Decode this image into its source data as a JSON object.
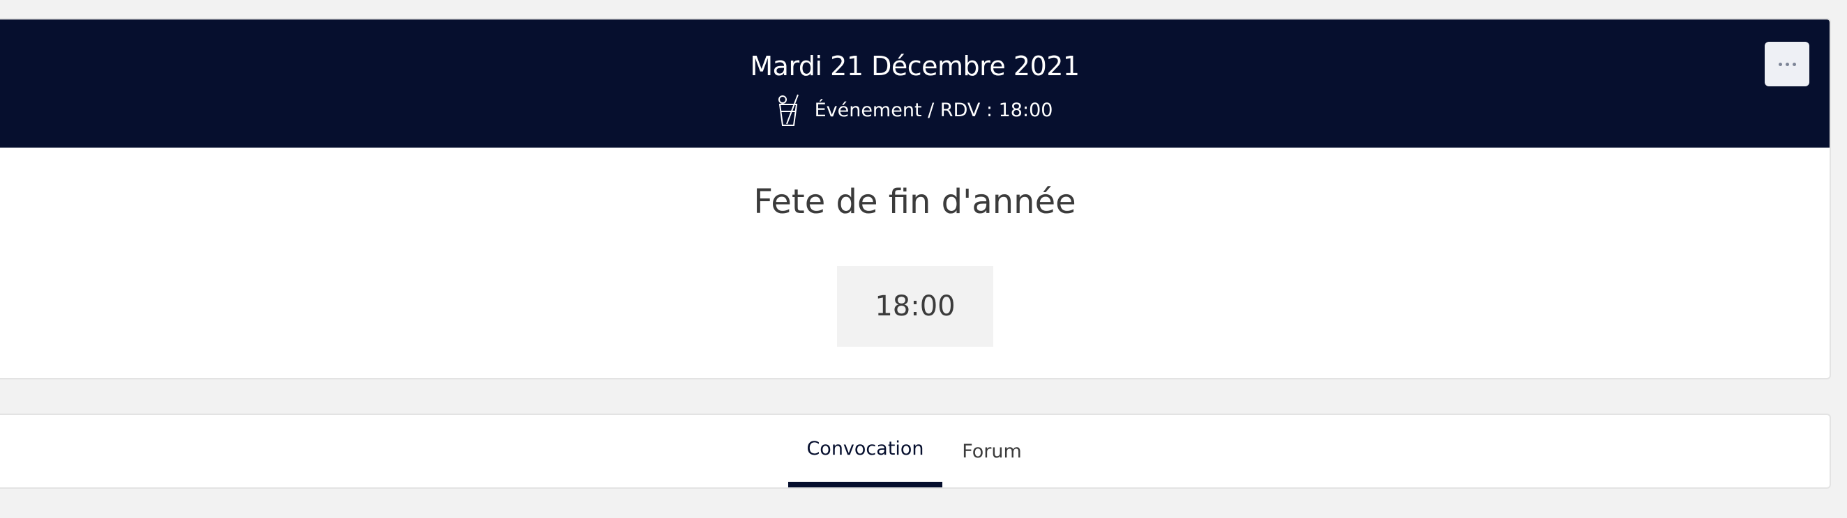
{
  "header": {
    "date": "Mardi 21 Décembre 2021",
    "subtitle": "Événement / RDV : 18:00",
    "icon": "cocktail-glass-icon",
    "background_color": "#060f2e"
  },
  "menu": {
    "icon": "more-horizontal-icon"
  },
  "event": {
    "title": "Fete de fin d'année",
    "time": "18:00"
  },
  "tabs": [
    {
      "label": "Convocation",
      "active": true
    },
    {
      "label": "Forum",
      "active": false
    }
  ],
  "colors": {
    "accent": "#060f2e",
    "page_background": "#f2f2f2",
    "text": "#3b3b3b"
  }
}
